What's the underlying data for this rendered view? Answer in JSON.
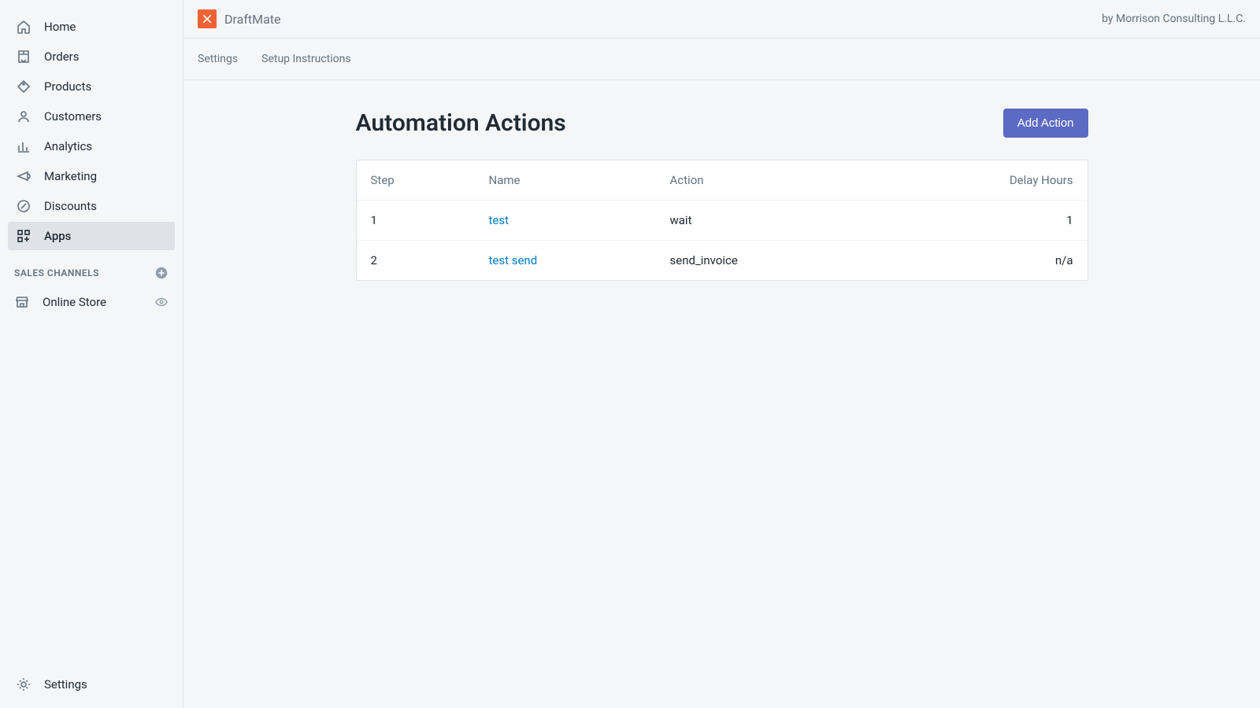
{
  "sidebar": {
    "nav": [
      {
        "label": "Home",
        "icon": "home"
      },
      {
        "label": "Orders",
        "icon": "orders"
      },
      {
        "label": "Products",
        "icon": "products"
      },
      {
        "label": "Customers",
        "icon": "customers"
      },
      {
        "label": "Analytics",
        "icon": "analytics"
      },
      {
        "label": "Marketing",
        "icon": "marketing"
      },
      {
        "label": "Discounts",
        "icon": "discounts"
      },
      {
        "label": "Apps",
        "icon": "apps",
        "active": true
      }
    ],
    "section_header": "SALES CHANNELS",
    "channels": [
      {
        "label": "Online Store",
        "icon": "store"
      }
    ],
    "settings_label": "Settings"
  },
  "topbar": {
    "app_name": "DraftMate",
    "byline": "by Morrison Consulting L.L.C."
  },
  "tabs": [
    {
      "label": "Settings"
    },
    {
      "label": "Setup Instructions"
    }
  ],
  "main": {
    "title": "Automation Actions",
    "add_button_label": "Add Action",
    "columns": {
      "step": "Step",
      "name": "Name",
      "action": "Action",
      "delay": "Delay Hours"
    },
    "rows": [
      {
        "step": "1",
        "name": "test",
        "action": "wait",
        "delay": "1"
      },
      {
        "step": "2",
        "name": "test send",
        "action": "send_invoice",
        "delay": "n/a"
      }
    ]
  }
}
